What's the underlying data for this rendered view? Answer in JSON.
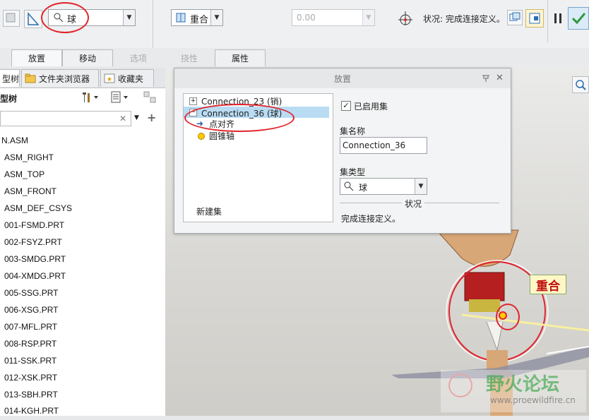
{
  "toolbar": {
    "constraint_type": "球",
    "offset_type": "重合",
    "offset_value": "0.00",
    "status_text": "状况: 完成连接定义。"
  },
  "tabs": [
    "放置",
    "移动",
    "选项",
    "挠性",
    "属性"
  ],
  "tree_panel": {
    "tabs": [
      "型树",
      "文件夹浏览器",
      "收藏夹"
    ],
    "label": "型树",
    "items": [
      "N.ASM",
      "ASM_RIGHT",
      "ASM_TOP",
      "ASM_FRONT",
      "ASM_DEF_CSYS",
      "001-FSMD.PRT",
      "002-FSYZ.PRT",
      "003-SMDG.PRT",
      "004-XMDG.PRT",
      "005-SSG.PRT",
      "006-XSG.PRT",
      "007-MFL.PRT",
      "008-RSP.PRT",
      "011-SSK.PRT",
      "012-XSK.PRT",
      "013-SBH.PRT",
      "014-KGH.PRT"
    ]
  },
  "dialog": {
    "title": "放置",
    "list": {
      "connection_1": "Connection_23 (销)",
      "connection_2": "Connection_36 (球)",
      "child_1": "点对齐",
      "child_2": "圆锥轴",
      "new_set": "新建集"
    },
    "enabled_label": "已启用集",
    "set_name_label": "集名称",
    "set_name_value": "Connection_36",
    "set_type_label": "集类型",
    "set_type_value": "球",
    "status_label": "状况",
    "status_value": "完成连接定义。"
  },
  "viewport": {
    "callout": "重合",
    "watermark_cn": "野火论坛",
    "watermark_url": "www.proewildfire.cn"
  }
}
